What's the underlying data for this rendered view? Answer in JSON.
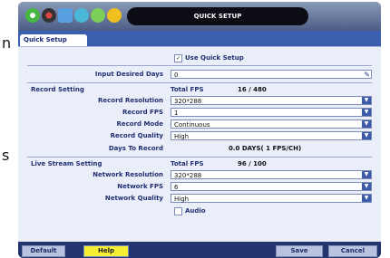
{
  "side_letters": {
    "top": "n",
    "middle": "s"
  },
  "window": {
    "title": "QUICK SETUP",
    "icons": [
      "status-icon",
      "record-icon",
      "calendar-icon",
      "search-icon",
      "network-icon",
      "settings-icon"
    ]
  },
  "tabs": [
    "Quick Setup"
  ],
  "use_quick_setup": {
    "label": "Use Quick Setup",
    "checked": true
  },
  "input_desired_days": {
    "label": "Input Desired Days",
    "value": "0"
  },
  "record_setting": {
    "section_label": "Record Setting",
    "total_fps_label": "Total FPS",
    "total_fps_value": "16 / 480",
    "resolution": {
      "label": "Record Resolution",
      "value": "320*288"
    },
    "fps": {
      "label": "Record FPS",
      "value": "1"
    },
    "mode": {
      "label": "Record Mode",
      "value": "Continuous"
    },
    "quality": {
      "label": "Record Quality",
      "value": "High"
    },
    "days_to_record": {
      "label": "Days To Record",
      "value": "0.0 DAYS( 1 FPS/CH)"
    }
  },
  "live_stream_setting": {
    "section_label": "Live Stream Setting",
    "total_fps_label": "Total FPS",
    "total_fps_value": "96 / 100",
    "resolution": {
      "label": "Network Resolution",
      "value": "320*288"
    },
    "fps": {
      "label": "Network FPS",
      "value": "6"
    },
    "quality": {
      "label": "Network Quality",
      "value": "High"
    },
    "audio": {
      "label": "Audio",
      "checked": false
    }
  },
  "buttons": {
    "default": "Default",
    "help": "Help",
    "save": "Save",
    "cancel": "Cancel"
  },
  "colors": {
    "frame": "#1a2a5a",
    "panel": "#e9eef8",
    "help": "#f6ef33"
  }
}
